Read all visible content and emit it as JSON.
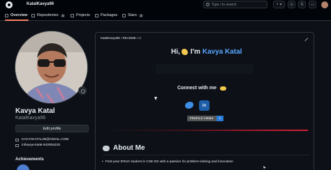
{
  "header": {
    "username": "KatalKavya96",
    "search_placeholder": "Type / to search",
    "new_label": "+ ▾"
  },
  "tabs": [
    {
      "label": "Overview",
      "icon": "book-icon"
    },
    {
      "label": "Repositories",
      "count": "4",
      "icon": "repo-icon"
    },
    {
      "label": "Projects",
      "icon": "table-icon"
    },
    {
      "label": "Packages",
      "icon": "package-icon"
    },
    {
      "label": "Stars",
      "count": "2",
      "icon": "star-icon"
    }
  ],
  "profile": {
    "full_name": "Kavya Katal",
    "login": "KatalKavya96",
    "edit_label": "Edit profile",
    "email": "KAVYAKATAL09@GMAIL.COM",
    "linkedin": "in/kavya-katal-64260a318",
    "achievements_title": "Achievements"
  },
  "readme": {
    "path_user": "KatalKavya96",
    "path_file": "README",
    "path_ext": ".md",
    "greeting": "Hi,",
    "greeting_im": "I'm",
    "greeting_name": "Kavya Katal",
    "connect_title": "Connect with me",
    "linkedin_letters": "in",
    "views_label": "PROFILE VIEWS",
    "views_count": "3",
    "about_title": "About Me",
    "about_bullet": "First-year BTech student in CSE-DS with a passion for problem-solving and innovation"
  }
}
